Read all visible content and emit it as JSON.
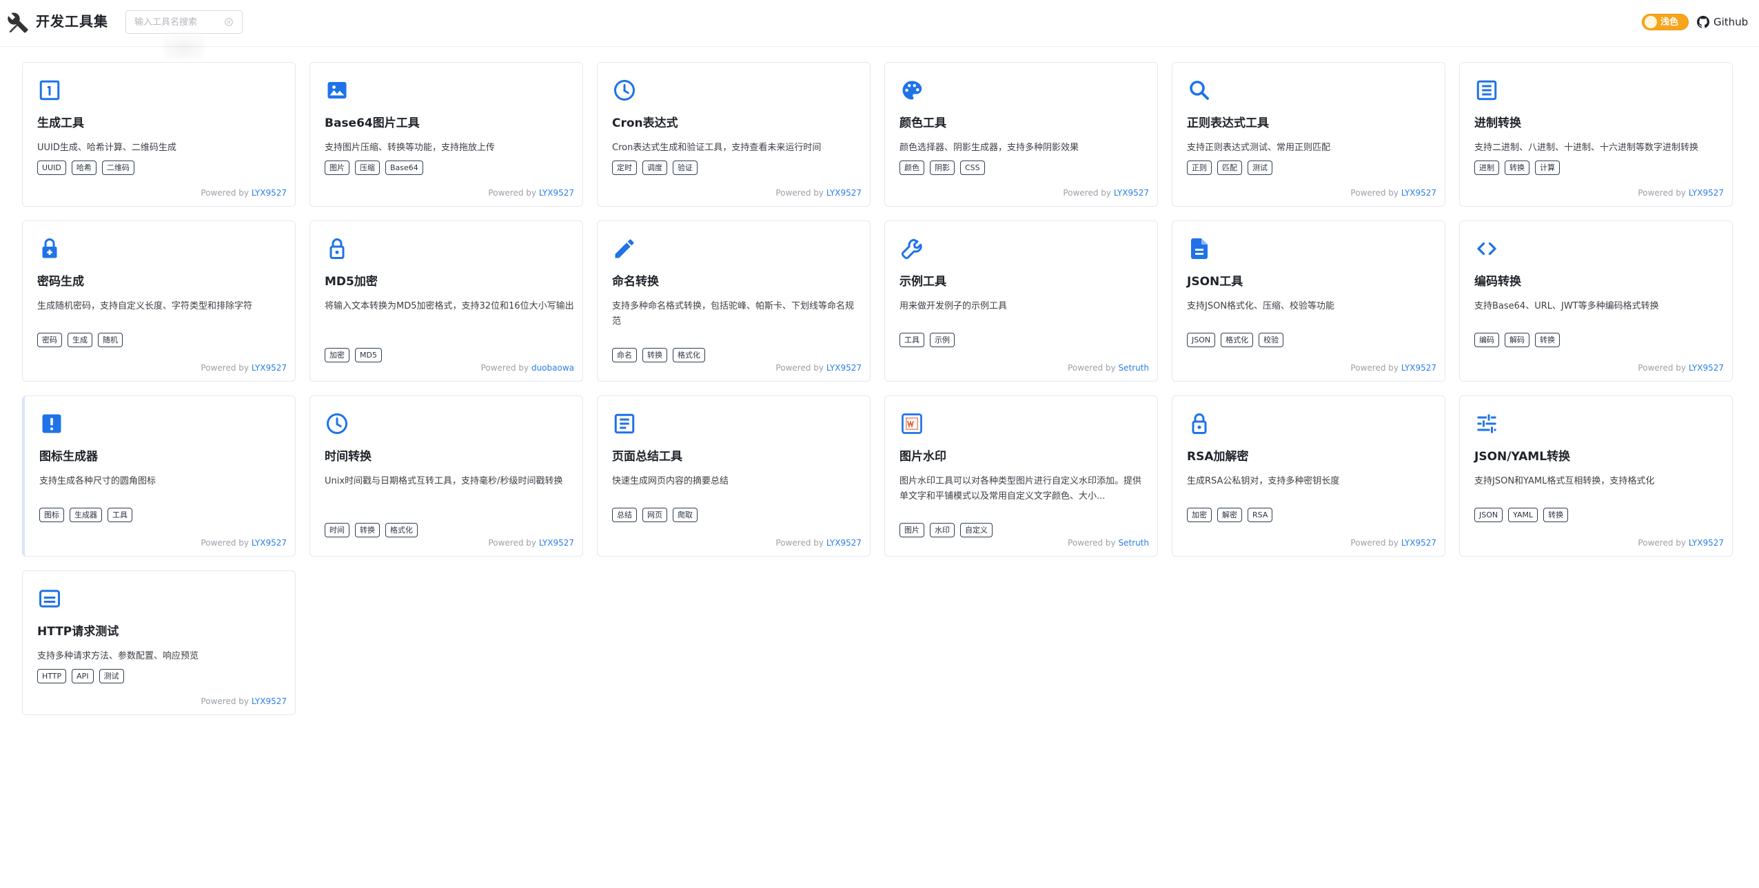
{
  "header": {
    "title": "开发工具集",
    "search_placeholder": "输入工具名搜索",
    "theme_label": "浅色",
    "github_label": "Github",
    "logo_icon": "tools-icon"
  },
  "colors": {
    "accent": "#2b7de9",
    "theme_button": "#f7a51c"
  },
  "powered_prefix": "Powered by",
  "tools": [
    {
      "title": "生成工具",
      "desc": "UUID生成、哈希计算、二维码生成",
      "tags": [
        "UUID",
        "哈希",
        "二维码"
      ],
      "author": "LYX9527",
      "icon": "counter-1-icon"
    },
    {
      "title": "Base64图片工具",
      "desc": "支持图片压缩、转换等功能，支持拖放上传",
      "tags": [
        "图片",
        "压缩",
        "Base64"
      ],
      "author": "LYX9527",
      "icon": "image-icon"
    },
    {
      "title": "Cron表达式",
      "desc": "Cron表达式生成和验证工具，支持查看未来运行时间",
      "tags": [
        "定时",
        "调度",
        "验证"
      ],
      "author": "LYX9527",
      "icon": "clock-icon"
    },
    {
      "title": "颜色工具",
      "desc": "颜色选择器、阴影生成器，支持多种阴影效果",
      "tags": [
        "颜色",
        "阴影",
        "CSS"
      ],
      "author": "LYX9527",
      "icon": "palette-icon"
    },
    {
      "title": "正则表达式工具",
      "desc": "支持正则表达式测试、常用正则匹配",
      "tags": [
        "正则",
        "匹配",
        "测试"
      ],
      "author": "LYX9527",
      "icon": "search-icon"
    },
    {
      "title": "进制转换",
      "desc": "支持二进制、八进制、十进制、十六进制等数字进制转换",
      "tags": [
        "进制",
        "转换",
        "计算"
      ],
      "author": "LYX9527",
      "icon": "list-alt-icon"
    },
    {
      "title": "密码生成",
      "desc": "生成随机密码，支持自定义长度、字符类型和排除字符",
      "tags": [
        "密码",
        "生成",
        "随机"
      ],
      "author": "LYX9527",
      "icon": "lock-plus-icon"
    },
    {
      "title": "MD5加密",
      "desc": "将输入文本转换为MD5加密格式，支持32位和16位大小写输出",
      "tags": [
        "加密",
        "MD5"
      ],
      "author": "duobaowa",
      "icon": "lock-icon"
    },
    {
      "title": "命名转换",
      "desc": "支持多种命名格式转换，包括驼峰、帕斯卡、下划线等命名规范",
      "tags": [
        "命名",
        "转换",
        "格式化"
      ],
      "author": "LYX9527",
      "icon": "pencil-icon"
    },
    {
      "title": "示例工具",
      "desc": "用来做开发例子的示例工具",
      "tags": [
        "工具",
        "示例"
      ],
      "author": "Setruth",
      "icon": "wrench-icon"
    },
    {
      "title": "JSON工具",
      "desc": "支持JSON格式化、压缩、校验等功能",
      "tags": [
        "JSON",
        "格式化",
        "校验"
      ],
      "author": "LYX9527",
      "icon": "file-text-icon"
    },
    {
      "title": "编码转换",
      "desc": "支持Base64、URL、JWT等多种编码格式转换",
      "tags": [
        "编码",
        "解码",
        "转换"
      ],
      "author": "LYX9527",
      "icon": "code-icon"
    },
    {
      "title": "图标生成器",
      "desc": "支持生成各种尺寸的圆角图标",
      "tags": [
        "图标",
        "生成器",
        "工具"
      ],
      "author": "LYX9527",
      "icon": "alert-box-icon"
    },
    {
      "title": "时间转换",
      "desc": "Unix时间戳与日期格式互转工具，支持毫秒/秒级时间戳转换",
      "tags": [
        "时间",
        "转换",
        "格式化"
      ],
      "author": "LYX9527",
      "icon": "clock-icon"
    },
    {
      "title": "页面总结工具",
      "desc": "快速生成网页内容的摘要总结",
      "tags": [
        "总结",
        "网页",
        "爬取"
      ],
      "author": "LYX9527",
      "icon": "article-icon"
    },
    {
      "title": "图片水印",
      "desc": "图片水印工具可以对各种类型图片进行自定义水印添加。提供单文字和平铺模式以及常用自定义文字颜色、大小...",
      "tags": [
        "图片",
        "水印",
        "自定义"
      ],
      "author": "Setruth",
      "icon": "watermark-icon"
    },
    {
      "title": "RSA加解密",
      "desc": "生成RSA公私钥对，支持多种密钥长度",
      "tags": [
        "加密",
        "解密",
        "RSA"
      ],
      "author": "LYX9527",
      "icon": "lock-icon"
    },
    {
      "title": "JSON/YAML转换",
      "desc": "支持JSON和YAML格式互相转换，支持格式化",
      "tags": [
        "JSON",
        "YAML",
        "转换"
      ],
      "author": "LYX9527",
      "icon": "sliders-icon"
    },
    {
      "title": "HTTP请求测试",
      "desc": "支持多种请求方法、参数配置、响应预览",
      "tags": [
        "HTTP",
        "API",
        "测试"
      ],
      "author": "LYX9527",
      "icon": "subtitles-icon"
    }
  ]
}
